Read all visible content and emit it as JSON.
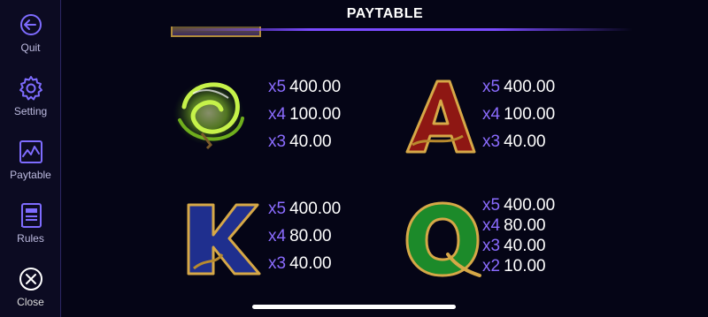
{
  "sidebar": {
    "items": [
      {
        "label": "Quit",
        "icon": "quit-arrow-icon"
      },
      {
        "label": "Setting",
        "icon": "gear-icon"
      },
      {
        "label": "Paytable",
        "icon": "chart-icon"
      },
      {
        "label": "Rules",
        "icon": "book-icon"
      },
      {
        "label": "Close",
        "icon": "close-icon"
      }
    ]
  },
  "header": {
    "title": "PAYTABLE"
  },
  "paytable": [
    {
      "symbol": "Wild swirl",
      "rows": [
        {
          "mult": "x5",
          "amount": "400.00"
        },
        {
          "mult": "x4",
          "amount": "100.00"
        },
        {
          "mult": "x3",
          "amount": "40.00"
        }
      ]
    },
    {
      "symbol": "A",
      "rows": [
        {
          "mult": "x5",
          "amount": "400.00"
        },
        {
          "mult": "x4",
          "amount": "100.00"
        },
        {
          "mult": "x3",
          "amount": "40.00"
        }
      ]
    },
    {
      "symbol": "K",
      "rows": [
        {
          "mult": "x5",
          "amount": "400.00"
        },
        {
          "mult": "x4",
          "amount": "80.00"
        },
        {
          "mult": "x3",
          "amount": "40.00"
        }
      ]
    },
    {
      "symbol": "Q",
      "rows": [
        {
          "mult": "x5",
          "amount": "400.00"
        },
        {
          "mult": "x4",
          "amount": "80.00"
        },
        {
          "mult": "x3",
          "amount": "40.00"
        },
        {
          "mult": "x2",
          "amount": "10.00"
        }
      ]
    }
  ],
  "colors": {
    "accent": "#8b6cff",
    "background": "#050516",
    "sidebar": "#0c0b22",
    "gold": "#c9a048"
  }
}
